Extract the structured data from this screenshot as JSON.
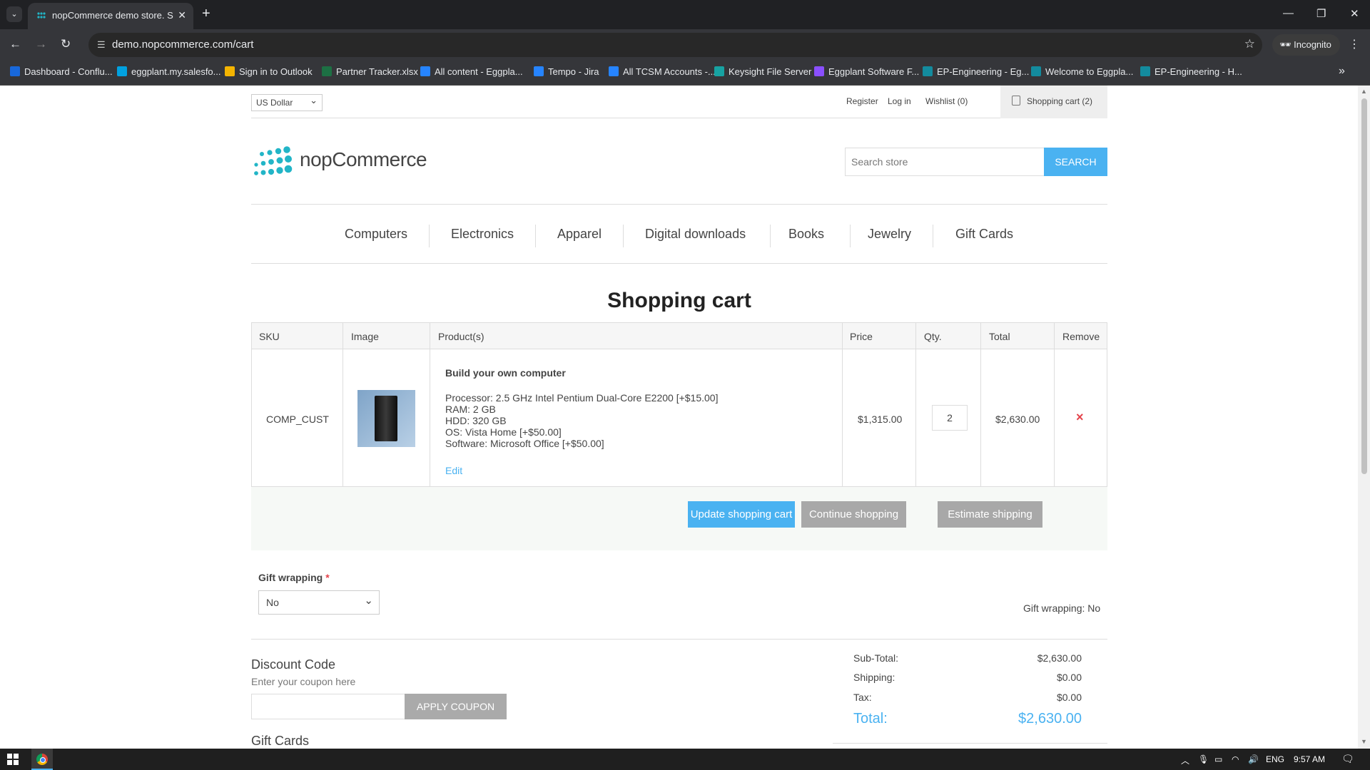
{
  "browser": {
    "tab_title": "nopCommerce demo store. Sh",
    "url": "demo.nopcommerce.com/cart",
    "incognito_label": "Incognito",
    "bookmarks": [
      {
        "label": "Dashboard - Conflu...",
        "color": "#1868db"
      },
      {
        "label": "eggplant.my.salesfo...",
        "color": "#00a1e0"
      },
      {
        "label": "Sign in to Outlook",
        "color": "#f4b400"
      },
      {
        "label": "Partner Tracker.xlsx",
        "color": "#1d7044"
      },
      {
        "label": "All content - Eggpla...",
        "color": "#2684ff"
      },
      {
        "label": "Tempo - Jira",
        "color": "#2684ff"
      },
      {
        "label": "All TCSM Accounts -...",
        "color": "#2684ff"
      },
      {
        "label": "Keysight File Server",
        "color": "#17a2a2"
      },
      {
        "label": "Eggplant Software F...",
        "color": "#8a4fff"
      },
      {
        "label": "EP-Engineering - Eg...",
        "color": "#138b9e"
      },
      {
        "label": "Welcome to Eggpla...",
        "color": "#138b9e"
      },
      {
        "label": "EP-Engineering - H...",
        "color": "#138b9e"
      }
    ]
  },
  "header": {
    "currency": "US Dollar",
    "register": "Register",
    "login": "Log in",
    "wishlist": "Wishlist (0)",
    "cart": "Shopping cart (2)",
    "logo_text": "nopCommerce",
    "search_placeholder": "Search store",
    "search_button": "SEARCH"
  },
  "menu": [
    "Computers",
    "Electronics",
    "Apparel",
    "Digital downloads",
    "Books",
    "Jewelry",
    "Gift Cards"
  ],
  "page_title": "Shopping cart",
  "table": {
    "headers": [
      "SKU",
      "Image",
      "Product(s)",
      "Price",
      "Qty.",
      "Total",
      "Remove"
    ],
    "row": {
      "sku": "COMP_CUST",
      "name": "Build your own computer",
      "attributes": [
        "Processor: 2.5 GHz Intel Pentium Dual-Core E2200 [+$15.00]",
        "RAM: 2 GB",
        "HDD: 320 GB",
        "OS: Vista Home [+$50.00]",
        "Software: Microsoft Office [+$50.00]"
      ],
      "edit": "Edit",
      "price": "$1,315.00",
      "qty": "2",
      "total": "$2,630.00",
      "remove_icon": "×"
    }
  },
  "buttons": {
    "update": "Update shopping cart",
    "continue": "Continue shopping",
    "estimate": "Estimate shipping"
  },
  "gift_wrapping": {
    "label": "Gift wrapping",
    "required": "*",
    "selected": "No",
    "summary": "Gift wrapping: No"
  },
  "discount": {
    "title": "Discount Code",
    "hint": "Enter your coupon here",
    "button": "APPLY COUPON"
  },
  "gift_cards_title": "Gift Cards",
  "totals": {
    "subtotal_label": "Sub-Total:",
    "subtotal": "$2,630.00",
    "shipping_label": "Shipping:",
    "shipping": "$0.00",
    "tax_label": "Tax:",
    "tax": "$0.00",
    "total_label": "Total:",
    "total": "$2,630.00"
  },
  "taskbar": {
    "lang": "ENG",
    "time": "9:57 AM"
  },
  "colors": {
    "accent": "#4ab2f1",
    "button_gray": "#a8a8a8",
    "remove_red": "#e4434b"
  }
}
